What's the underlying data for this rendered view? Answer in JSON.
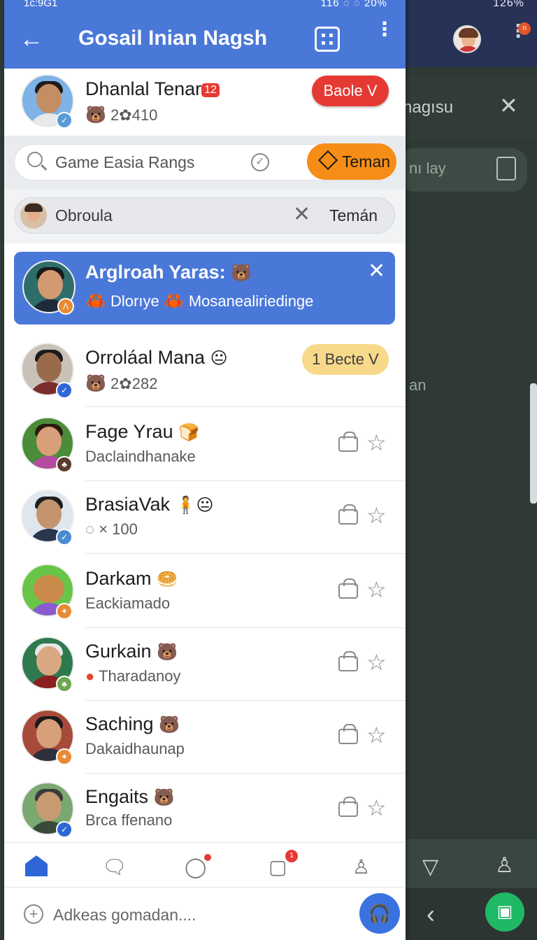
{
  "status": {
    "time": "1c:9G1",
    "right": "116  ◌ ◌ 20%",
    "bg_right": "126%"
  },
  "appbar": {
    "title": "Gosail Inian Nagsh"
  },
  "bg": {
    "title": "nagısu",
    "input_text": "nı lay",
    "list_text": "an"
  },
  "top_contact": {
    "name": "Dhanlal Tenar",
    "badge": "12",
    "sub": "2",
    "count": "410",
    "action": "Baole V"
  },
  "search": {
    "placeholder": "Game Easia Rangs",
    "button": "Teman"
  },
  "chip": {
    "label": "Obroula",
    "action": "Temán"
  },
  "highlight": {
    "name": "Arglroah Yaras:",
    "sub1": "Dlorıye",
    "sub2": "Mosanealiriedinge"
  },
  "contacts": [
    {
      "name": "Orroláal Mana",
      "sub": "2",
      "count": "282",
      "action": "1 Becte V"
    },
    {
      "name": "Fage Yrau",
      "sub": "Daclaindhanake"
    },
    {
      "name": "BrasiaVak",
      "sub": "× 100"
    },
    {
      "name": "Darkam",
      "sub": "Eackiamado"
    },
    {
      "name": "Gurkain",
      "sub": "Tharadanoy"
    },
    {
      "name": "Saching",
      "sub": "Dakaidhaunap"
    },
    {
      "name": "Engaits",
      "sub": "Brca ffenano"
    }
  ],
  "nav_badge": "1",
  "composer": {
    "placeholder": "Adkeas gomadan...."
  },
  "colors": {
    "primary": "#4a78d9",
    "accent_orange": "#f68d16",
    "accent_red": "#e53a33",
    "accent_yellow": "#f8d98a",
    "fab_green": "#1fb866"
  }
}
